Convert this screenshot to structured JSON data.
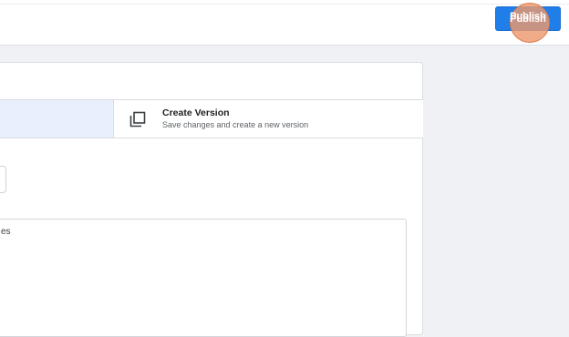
{
  "header": {
    "publish_label": "Publish"
  },
  "create_version": {
    "title": "Create Version",
    "description": "Save changes and create a new version",
    "icon": "copy-stack-icon"
  },
  "description_field": {
    "visible_text": "es"
  },
  "colors": {
    "primary": "#1f7ee8",
    "selected_option_bg": "#e8f0fd",
    "click_indicator": "#ed986e",
    "page_bg": "#eff1f4"
  }
}
